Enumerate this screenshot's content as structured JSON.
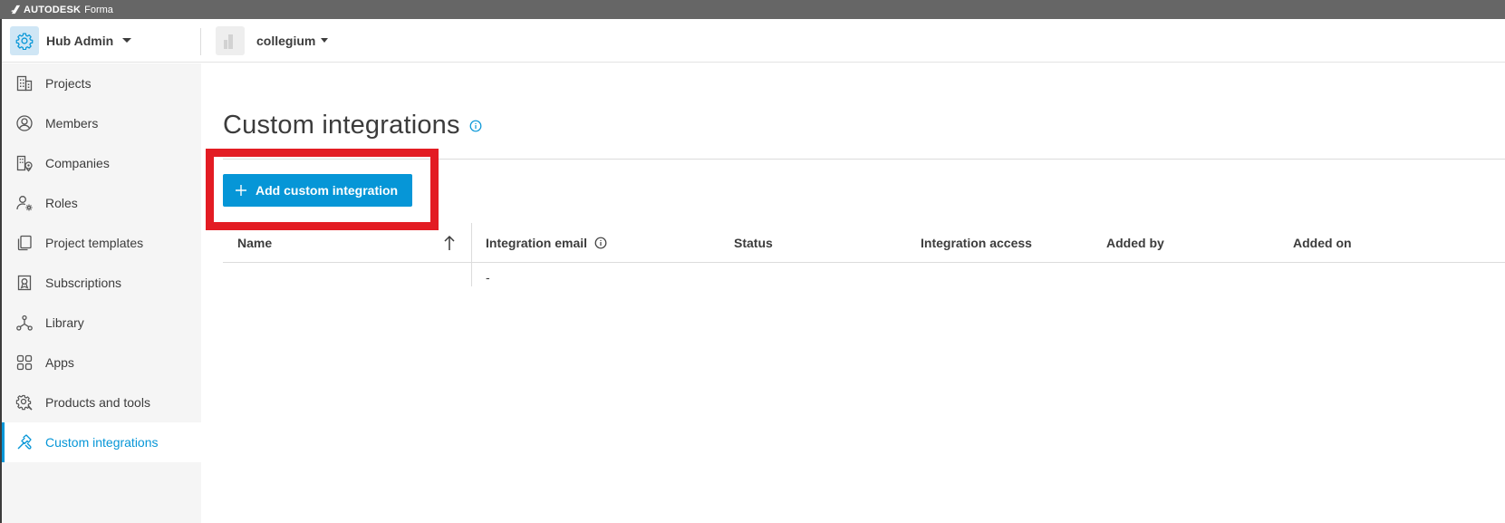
{
  "topbar": {
    "brand_name": "AUTODESK",
    "product_name": "Forma"
  },
  "hub": {
    "title": "Hub Admin",
    "icon": "gear-icon"
  },
  "project": {
    "name": "collegium"
  },
  "sidebar": {
    "items": [
      {
        "label": "Projects",
        "icon": "building-icon"
      },
      {
        "label": "Members",
        "icon": "user-circle-icon"
      },
      {
        "label": "Companies",
        "icon": "company-location-icon"
      },
      {
        "label": "Roles",
        "icon": "user-gear-icon"
      },
      {
        "label": "Project templates",
        "icon": "templates-icon"
      },
      {
        "label": "Subscriptions",
        "icon": "subscription-icon"
      },
      {
        "label": "Library",
        "icon": "library-icon"
      },
      {
        "label": "Apps",
        "icon": "apps-grid-icon"
      },
      {
        "label": "Products and tools",
        "icon": "tools-gear-icon"
      },
      {
        "label": "Custom integrations",
        "icon": "integration-tools-icon",
        "active": true
      }
    ]
  },
  "main": {
    "title": "Custom integrations",
    "add_button_label": "Add custom integration",
    "table": {
      "columns": [
        "Name",
        "Integration email",
        "Status",
        "Integration access",
        "Added by",
        "Added on"
      ],
      "rows": [
        {
          "integration_email": "-"
        }
      ]
    }
  },
  "colors": {
    "accent": "#0696d7",
    "highlight": "#e31c23",
    "topbar": "#666666",
    "sidebar_bg": "#f5f5f5"
  }
}
